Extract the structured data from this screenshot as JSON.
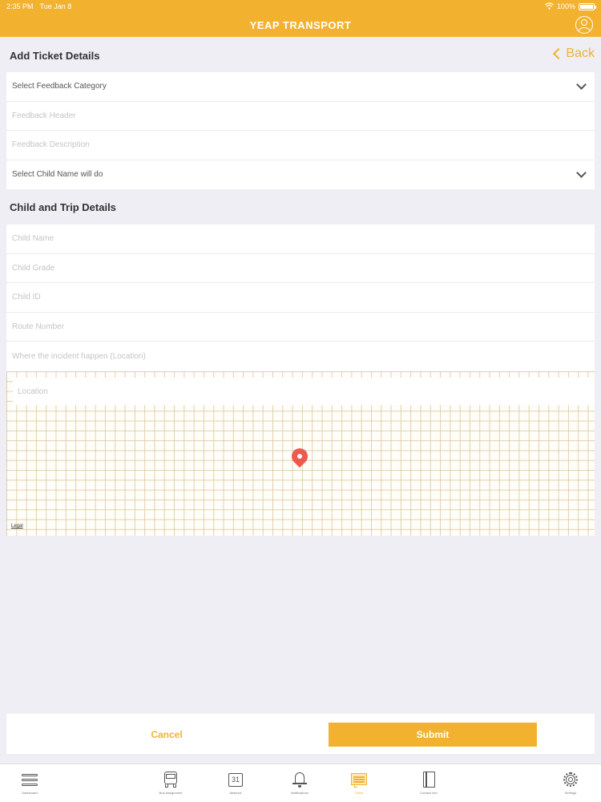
{
  "status_bar": {
    "time": "2:35 PM",
    "date": "Tue Jan 8",
    "battery": "100%"
  },
  "nav": {
    "title": "YEAP TRANSPORT"
  },
  "colors": {
    "accent": "#f2b230",
    "pin": "#f05a4e",
    "background": "#eeeef4"
  },
  "ticket_section": {
    "title": "Add Ticket Details",
    "back_label": "Back",
    "feedback_category": "Select Feedback Category",
    "feedback_header_placeholder": "Feedback Header",
    "feedback_description_placeholder": "Feedback Description",
    "child_select": "Select Child Name will do"
  },
  "trip_section": {
    "title": "Child and Trip Details",
    "child_name_placeholder": "Child Name",
    "child_grade_placeholder": "Child Grade",
    "child_id_placeholder": "Child ID",
    "route_number_placeholder": "Route Number",
    "incident_location_placeholder": "Where the incident happen (Location)"
  },
  "map": {
    "location_placeholder": "Location",
    "legal_label": "Legal"
  },
  "actions": {
    "cancel_label": "Cancel",
    "submit_label": "Submit"
  },
  "tabs": [
    {
      "label": "Dashboard",
      "icon": "menu-icon"
    },
    {
      "label": "Bus Assignment",
      "icon": "bus-icon"
    },
    {
      "label": "Absence",
      "icon": "calendar-icon",
      "calendar_day": "31"
    },
    {
      "label": "Notifications",
      "icon": "bell-icon"
    },
    {
      "label": "Ticket",
      "icon": "ticket-icon",
      "active": true
    },
    {
      "label": "Contact Info",
      "icon": "contact-book-icon"
    },
    {
      "label": "Settings",
      "icon": "gear-icon"
    }
  ]
}
